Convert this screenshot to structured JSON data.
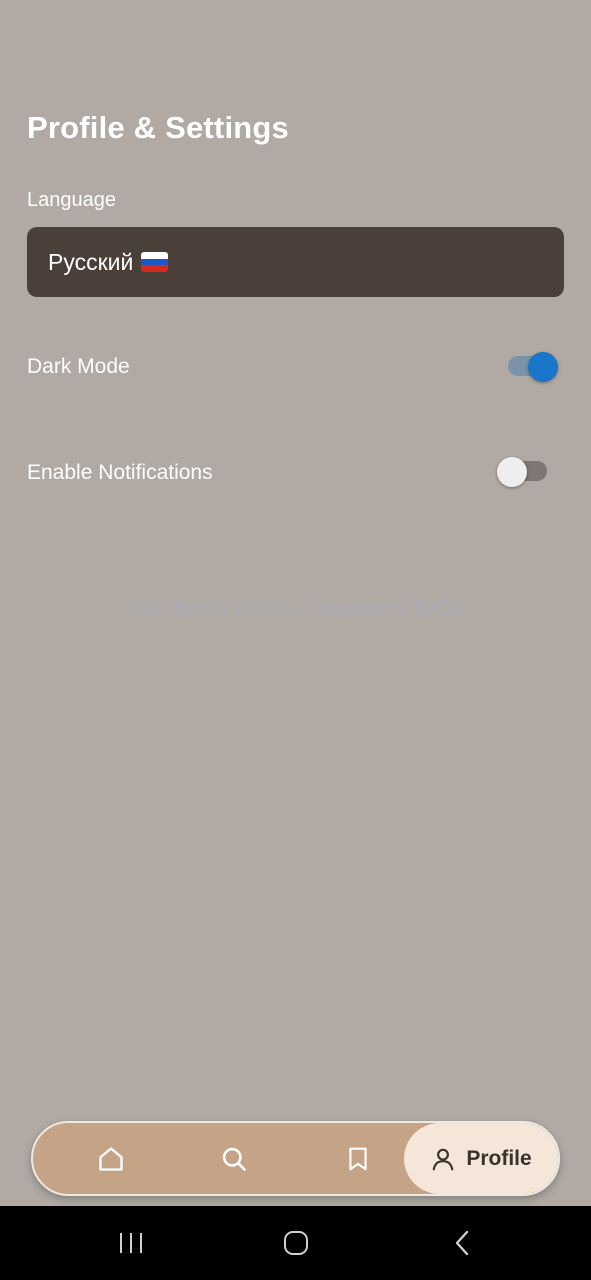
{
  "page": {
    "title": "Profile & Settings"
  },
  "language": {
    "label": "Language",
    "selected_value": "Русский",
    "flag_icon": "russia-flag-icon",
    "flag_colors": [
      "#ffffff",
      "#1c57c8",
      "#d52b1e"
    ]
  },
  "settings": [
    {
      "label": "Dark Mode",
      "enabled": true
    },
    {
      "label": "Enable Notifications",
      "enabled": false
    }
  ],
  "footer": {
    "note": "OKO Movies v1.0.0 — powered by TMDB"
  },
  "bottom_nav": {
    "items": [
      {
        "icon": "home-icon",
        "active": false
      },
      {
        "icon": "search-icon",
        "active": false
      },
      {
        "icon": "bookmark-icon",
        "active": false
      },
      {
        "icon": "person-icon",
        "label": "Profile",
        "active": true
      }
    ]
  },
  "system_nav": {
    "buttons": [
      "recent-apps-icon",
      "home-circle-icon",
      "back-chevron-icon"
    ]
  },
  "colors": {
    "background": "#b0a9a4",
    "select_bg": "#4a4039",
    "switch_on_thumb": "#1976c8",
    "switch_on_track": "#7a93a8",
    "switch_off_thumb": "#eeeeee",
    "switch_off_track": "#7d7672",
    "nav_bg": "#c4a386",
    "nav_active_bg": "#f4e6d8"
  }
}
